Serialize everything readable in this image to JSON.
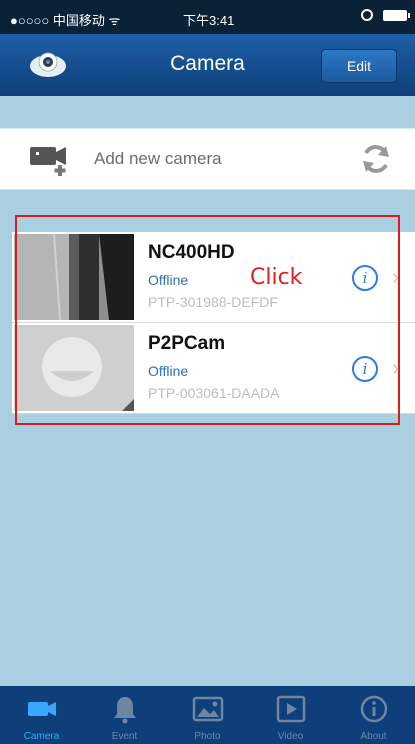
{
  "status_bar": {
    "carrier": "●○○○○ 中国移动 ᯤ",
    "time": "下午3:41"
  },
  "nav": {
    "title": "Camera",
    "edit_label": "Edit"
  },
  "add_camera": {
    "label": "Add new camera"
  },
  "cameras": [
    {
      "name": "NC400HD",
      "status": "Offline",
      "id": "PTP-301988-DEFDF"
    },
    {
      "name": "P2PCam",
      "status": "Offline",
      "id": "PTP-003061-DAADA"
    }
  ],
  "annotation": {
    "text": "Click"
  },
  "tabs": [
    {
      "label": "Camera",
      "icon": "camera-icon"
    },
    {
      "label": "Event",
      "icon": "bell-icon"
    },
    {
      "label": "Photo",
      "icon": "photo-icon"
    },
    {
      "label": "Video",
      "icon": "video-icon"
    },
    {
      "label": "About",
      "icon": "info-icon"
    }
  ],
  "colors": {
    "nav_blue": "#1d5fa7",
    "background": "#a9cfe0",
    "accent_blue": "#2b7de0",
    "annotation_red": "#e01b1b"
  }
}
